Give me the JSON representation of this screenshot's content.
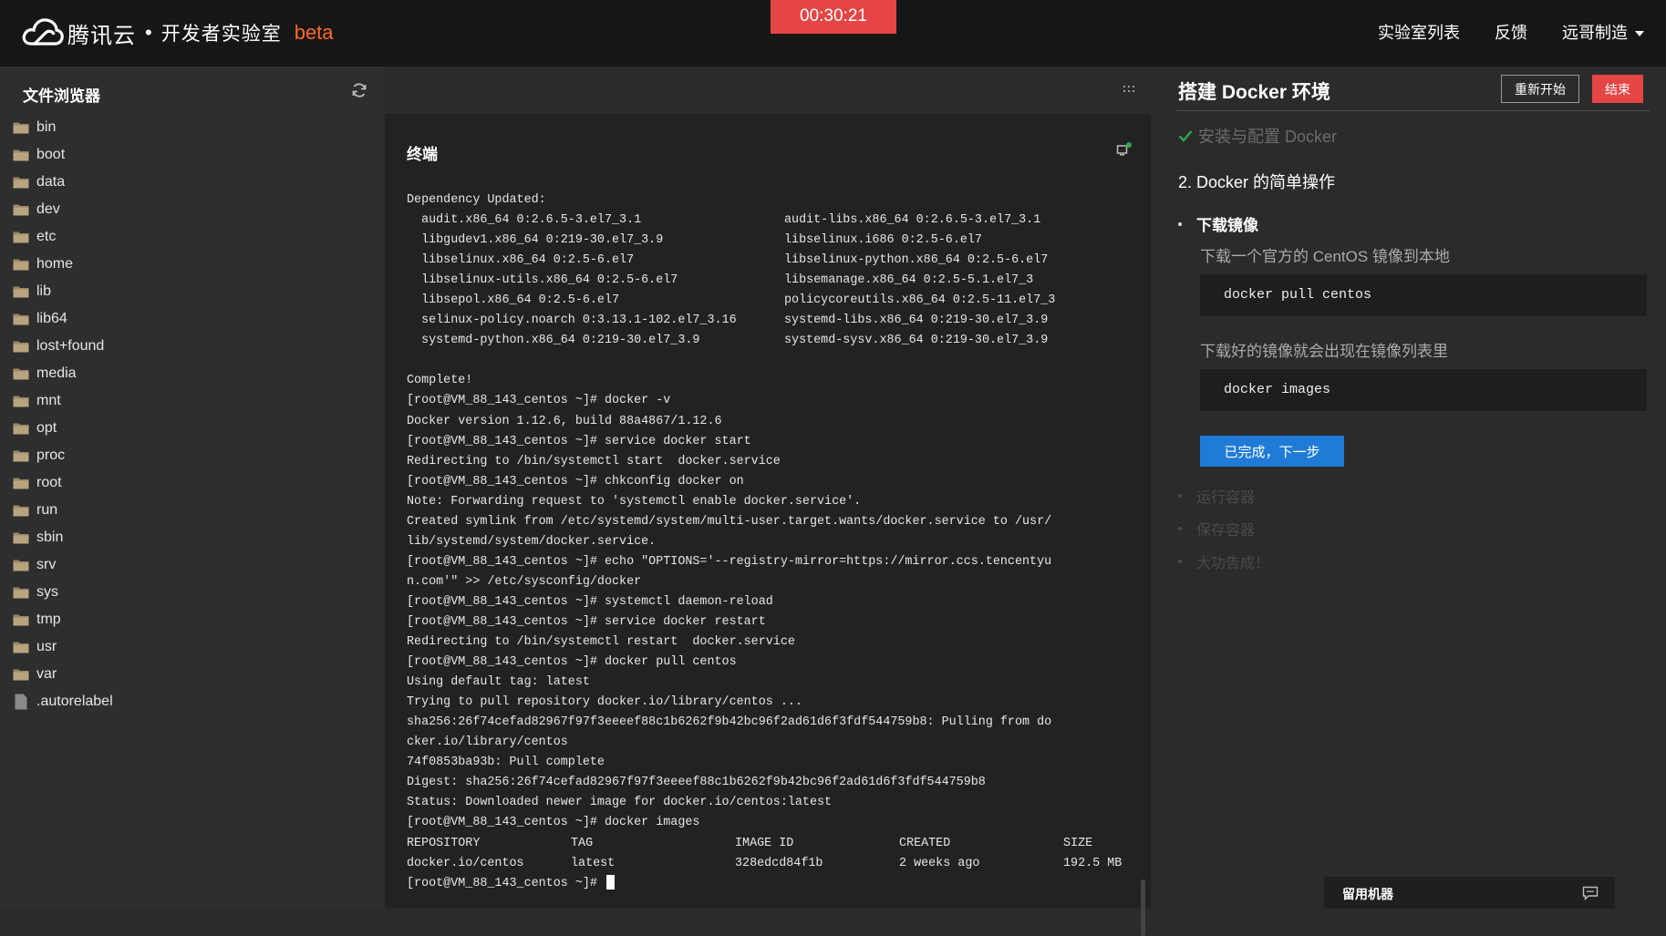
{
  "header": {
    "brand": "腾讯云",
    "separator": "•",
    "subtitle": "开发者实验室",
    "beta": "beta",
    "timer": "00:30:21",
    "nav": {
      "labs": "实验室列表",
      "feedback": "反馈",
      "user": "远哥制造"
    }
  },
  "colors": {
    "accent_red": "#e64545",
    "beta_orange": "#ff6a2b",
    "primary_blue": "#1f7bd6",
    "success_green": "#2ea84f"
  },
  "file_browser": {
    "title": "文件浏览器",
    "items": [
      {
        "name": "bin",
        "type": "folder"
      },
      {
        "name": "boot",
        "type": "folder"
      },
      {
        "name": "data",
        "type": "folder"
      },
      {
        "name": "dev",
        "type": "folder"
      },
      {
        "name": "etc",
        "type": "folder"
      },
      {
        "name": "home",
        "type": "folder"
      },
      {
        "name": "lib",
        "type": "folder"
      },
      {
        "name": "lib64",
        "type": "folder"
      },
      {
        "name": "lost+found",
        "type": "folder"
      },
      {
        "name": "media",
        "type": "folder"
      },
      {
        "name": "mnt",
        "type": "folder"
      },
      {
        "name": "opt",
        "type": "folder"
      },
      {
        "name": "proc",
        "type": "folder"
      },
      {
        "name": "root",
        "type": "folder"
      },
      {
        "name": "run",
        "type": "folder"
      },
      {
        "name": "sbin",
        "type": "folder"
      },
      {
        "name": "srv",
        "type": "folder"
      },
      {
        "name": "sys",
        "type": "folder"
      },
      {
        "name": "tmp",
        "type": "folder"
      },
      {
        "name": "usr",
        "type": "folder"
      },
      {
        "name": "var",
        "type": "folder"
      },
      {
        "name": ".autorelabel",
        "type": "file"
      }
    ]
  },
  "terminal": {
    "title": "终端",
    "lines": [
      "Dependency Updated:",
      [
        "  audit.x86_64 0:2.6.5-3.el7_3.1",
        "audit-libs.x86_64 0:2.6.5-3.el7_3.1"
      ],
      [
        "  libgudev1.x86_64 0:219-30.el7_3.9",
        "libselinux.i686 0:2.5-6.el7"
      ],
      [
        "  libselinux.x86_64 0:2.5-6.el7",
        "libselinux-python.x86_64 0:2.5-6.el7"
      ],
      [
        "  libselinux-utils.x86_64 0:2.5-6.el7",
        "libsemanage.x86_64 0:2.5-5.1.el7_3"
      ],
      [
        "  libsepol.x86_64 0:2.5-6.el7",
        "policycoreutils.x86_64 0:2.5-11.el7_3"
      ],
      [
        "  selinux-policy.noarch 0:3.13.1-102.el7_3.16",
        "systemd-libs.x86_64 0:219-30.el7_3.9"
      ],
      [
        "  systemd-python.x86_64 0:219-30.el7_3.9",
        "systemd-sysv.x86_64 0:219-30.el7_3.9"
      ],
      "",
      "Complete!",
      "[root@VM_88_143_centos ~]# docker -v",
      "Docker version 1.12.6, build 88a4867/1.12.6",
      "[root@VM_88_143_centos ~]# service docker start",
      "Redirecting to /bin/systemctl start  docker.service",
      "[root@VM_88_143_centos ~]# chkconfig docker on",
      "Note: Forwarding request to 'systemctl enable docker.service'.",
      "Created symlink from /etc/systemd/system/multi-user.target.wants/docker.service to /usr/",
      "lib/systemd/system/docker.service.",
      "[root@VM_88_143_centos ~]# echo \"OPTIONS='--registry-mirror=https://mirror.ccs.tencentyu",
      "n.com'\" >> /etc/sysconfig/docker",
      "[root@VM_88_143_centos ~]# systemctl daemon-reload",
      "[root@VM_88_143_centos ~]# service docker restart",
      "Redirecting to /bin/systemctl restart  docker.service",
      "[root@VM_88_143_centos ~]# docker pull centos",
      "Using default tag: latest",
      "Trying to pull repository docker.io/library/centos ...",
      "sha256:26f74cefad82967f97f3eeeef88c1b6262f9b42bc96f2ad61d6f3fdf544759b8: Pulling from do",
      "cker.io/library/centos",
      "74f0853ba93b: Pull complete",
      "Digest: sha256:26f74cefad82967f97f3eeeef88c1b6262f9b42bc96f2ad61d6f3fdf544759b8",
      "Status: Downloaded newer image for docker.io/centos:latest",
      "[root@VM_88_143_centos ~]# docker images"
    ],
    "table_header": [
      "REPOSITORY",
      "TAG",
      "IMAGE ID",
      "CREATED",
      "SIZE"
    ],
    "table_row": [
      "docker.io/centos",
      "latest",
      "328edcd84f1b",
      "2 weeks ago",
      "192.5 MB"
    ],
    "prompt": "[root@VM_88_143_centos ~]# "
  },
  "tutorial": {
    "title": "搭建 Docker 环境",
    "restart": "重新开始",
    "end": "结束",
    "completed_step": "安装与配置 Docker",
    "current_step": "2. Docker 的简单操作",
    "current_sub": "下载镜像",
    "desc1": "下载一个官方的 CentOS 镜像到本地",
    "code1": "docker pull centos",
    "desc2": "下载好的镜像就会出现在镜像列表里",
    "code2": "docker images",
    "next": "已完成，下一步",
    "future_subs": [
      "运行容器",
      "保存容器",
      "大功告成！"
    ],
    "keep_machine": "留用机器"
  }
}
